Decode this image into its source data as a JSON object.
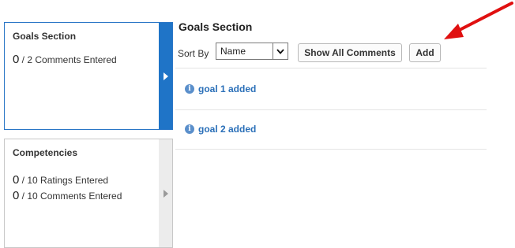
{
  "cards": {
    "goals": {
      "title": "Goals Section",
      "comments_num": "0",
      "comments_text": " / 2 Comments Entered"
    },
    "competencies": {
      "title": "Competencies",
      "ratings_num": "0",
      "ratings_text": " / 10 Ratings Entered",
      "comments_num": "0",
      "comments_text": " / 10 Comments Entered"
    }
  },
  "main": {
    "title": "Goals Section",
    "sort_label": "Sort By",
    "sort_value": "Name",
    "show_all_label": "Show All Comments",
    "add_label": "Add",
    "goals": [
      {
        "label": "goal 1 added"
      },
      {
        "label": "goal 2 added"
      }
    ]
  },
  "colors": {
    "accent": "#1f74c7",
    "link": "#2a6fb8",
    "annotation": "#e01010"
  },
  "icons": [
    "chevron-right-icon",
    "chevron-down-icon",
    "info-icon",
    "annotation-arrow"
  ]
}
